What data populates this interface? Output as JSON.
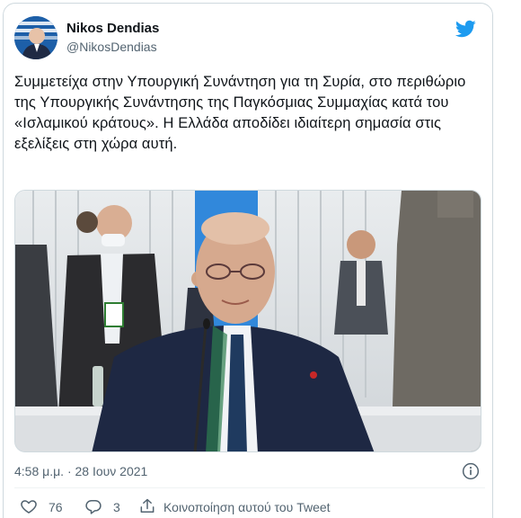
{
  "user": {
    "display_name": "Nikos Dendias",
    "handle": "@NikosDendias"
  },
  "tweet": {
    "text": "Συμμετείχα στην Υπουργική Συνάντηση για τη Συρία, στο περιθώριο της Υπουργικής Συνάντησης της Παγκόσμιας Συμμαχίας κατά του «Ισλαμικού κράτους». Η Ελλάδα αποδίδει ιδιαίτερη σημασία στις εξελίξεις στη χώρα αυτή."
  },
  "meta": {
    "timestamp": "4:58 μ.μ. · 28 Ιουν 2021"
  },
  "actions": {
    "likes": "76",
    "replies": "3",
    "share_label": "Κοινοποίηση αυτού του Tweet"
  },
  "colors": {
    "twitter_blue": "#1d9bf0",
    "text_primary": "#0f1419",
    "text_secondary": "#536471",
    "border": "#cfd9de"
  },
  "icons": [
    "twitter-bird-icon",
    "info-icon",
    "heart-icon",
    "reply-icon",
    "share-icon"
  ]
}
